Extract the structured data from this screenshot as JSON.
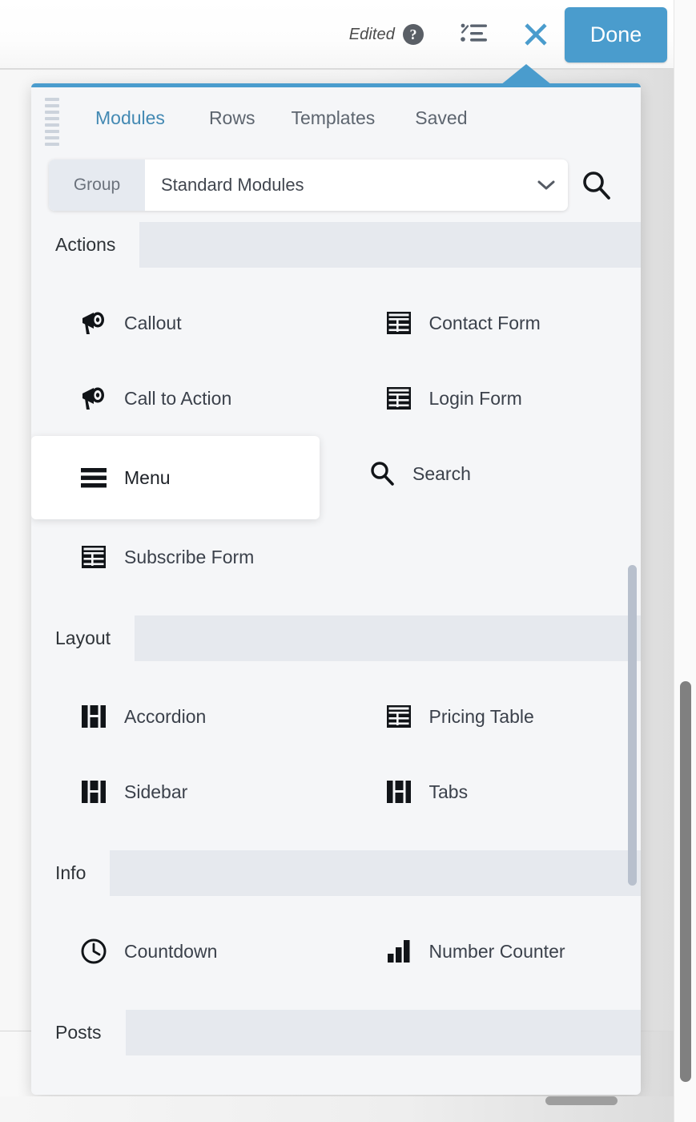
{
  "toolbar": {
    "edited_label": "Edited",
    "help_icon": "question-circle-icon",
    "outline_icon": "outline-list-icon",
    "close_icon": "close-x-icon",
    "done_label": "Done",
    "accent_color": "#4a9ccd"
  },
  "panel": {
    "drag_handle": "drag-handle-icon",
    "tabs": [
      {
        "label": "Modules",
        "active": true
      },
      {
        "label": "Rows",
        "active": false
      },
      {
        "label": "Templates",
        "active": false
      },
      {
        "label": "Saved",
        "active": false
      }
    ],
    "filter": {
      "group_label": "Group",
      "selected_value": "Standard Modules",
      "chevron_icon": "chevron-down-icon",
      "search_icon": "search-icon"
    },
    "sections": [
      {
        "title": "Actions",
        "items": [
          {
            "label": "Callout",
            "icon": "megaphone-icon",
            "hovered": false
          },
          {
            "label": "Contact Form",
            "icon": "form-table-icon",
            "hovered": false
          },
          {
            "label": "Call to Action",
            "icon": "megaphone-icon",
            "hovered": false
          },
          {
            "label": "Login Form",
            "icon": "form-table-icon",
            "hovered": false
          },
          {
            "label": "Menu",
            "icon": "hamburger-menu-icon",
            "hovered": true
          },
          {
            "label": "Search",
            "icon": "search-icon",
            "hovered": false
          },
          {
            "label": "Subscribe Form",
            "icon": "form-table-icon",
            "hovered": false
          }
        ]
      },
      {
        "title": "Layout",
        "items": [
          {
            "label": "Accordion",
            "icon": "columns-layout-icon",
            "hovered": false
          },
          {
            "label": "Pricing Table",
            "icon": "form-table-icon",
            "hovered": false
          },
          {
            "label": "Sidebar",
            "icon": "columns-layout-icon",
            "hovered": false
          },
          {
            "label": "Tabs",
            "icon": "columns-layout-icon",
            "hovered": false
          }
        ]
      },
      {
        "title": "Info",
        "items": [
          {
            "label": "Countdown",
            "icon": "clock-icon",
            "hovered": false
          },
          {
            "label": "Number Counter",
            "icon": "bar-chart-icon",
            "hovered": false
          }
        ]
      },
      {
        "title": "Posts",
        "items": []
      }
    ]
  },
  "scrollbars": {
    "inner_panel": "panel-vertical-scrollbar",
    "browser_vertical": "browser-vertical-scrollbar",
    "browser_horizontal": "browser-horizontal-scrollbar"
  }
}
